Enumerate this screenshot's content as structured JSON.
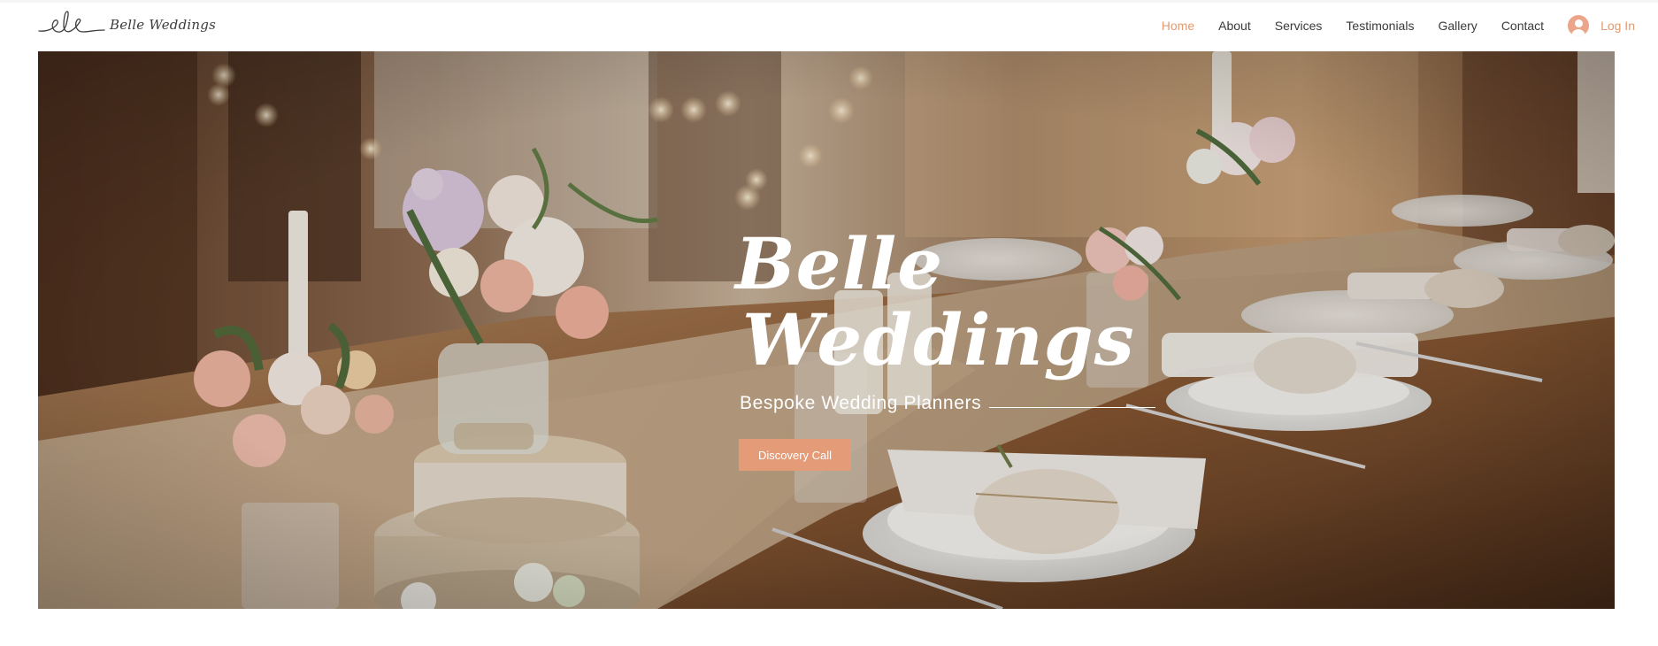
{
  "brand": {
    "name": "Belle Weddings",
    "logo_icon": "handwritten-ele-monogram"
  },
  "nav": {
    "items": [
      {
        "label": "Home",
        "active": true
      },
      {
        "label": "About",
        "active": false
      },
      {
        "label": "Services",
        "active": false
      },
      {
        "label": "Testimonials",
        "active": false
      },
      {
        "label": "Gallery",
        "active": false
      },
      {
        "label": "Contact",
        "active": false
      }
    ],
    "login": {
      "label": "Log In",
      "icon": "user-avatar-icon"
    }
  },
  "hero": {
    "title_line1": "Belle",
    "title_line2": "Weddings",
    "subtitle": "Bespoke Wedding Planners",
    "cta_label": "Discovery Call",
    "background": "rustic-wedding-table-with-flowers-photo"
  },
  "colors": {
    "accent": "#E39B78",
    "nav_active": "#E29A73",
    "text": "#3A3A3A",
    "background": "#FFFFFF"
  }
}
